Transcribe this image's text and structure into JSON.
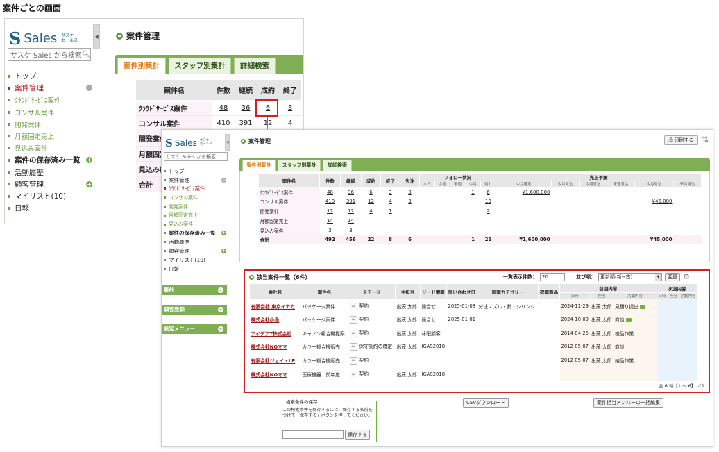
{
  "caption": "案件ごとの画面",
  "brand": {
    "letter": "S",
    "name": "Sales",
    "small_line1": "サスケ",
    "small_line2": "セールス"
  },
  "search_placeholder": "サスケ Sales から検索",
  "nav": [
    {
      "label": "トップ",
      "type": "top"
    },
    {
      "label": "案件管理",
      "type": "active",
      "toggle": "minus"
    },
    {
      "label": "ｸﾗｳﾄﾞｻｰﾋﾞｽ案件",
      "type": "sub"
    },
    {
      "label": "コンサル案件",
      "type": "sub"
    },
    {
      "label": "開発案件",
      "type": "sub"
    },
    {
      "label": "月額固定売上",
      "type": "sub"
    },
    {
      "label": "見込み案件",
      "type": "sub"
    },
    {
      "label": "案件の保存済み一覧",
      "type": "bold",
      "toggle": "plus"
    },
    {
      "label": "活動履歴",
      "type": "top"
    },
    {
      "label": "顧客管理",
      "type": "top",
      "toggle": "plus"
    },
    {
      "label": "マイリスト(10)",
      "type": "top"
    },
    {
      "label": "日報",
      "type": "top"
    }
  ],
  "sideboxes": [
    "集計",
    "顧客登録",
    "設定メニュー"
  ],
  "header": {
    "title": "案件管理",
    "print_label": "印刷する"
  },
  "tabs": [
    "案件別集計",
    "スタッフ別集計",
    "詳細検索"
  ],
  "summary": {
    "headers": [
      "案件名",
      "件数",
      "継続",
      "成約",
      "終了",
      "失注"
    ],
    "follow_header": "フォロー状況",
    "follow_sub": [
      "本日",
      "今週",
      "来週",
      "今月",
      "遅れ"
    ],
    "forecast_header": "売上予測",
    "forecast_sub": [
      "今月確定",
      "今月見込",
      "今週見込",
      "来週見込",
      "今月見込",
      "来月見込"
    ],
    "rows": [
      {
        "name": "ｸﾗｳﾄﾞｻｰﾋﾞｽ案件",
        "count": "48",
        "cont": "36",
        "won": "6",
        "end": "3",
        "lost": "3",
        "f_month": "1",
        "f_late": "6",
        "p1": "¥1,600,000",
        "p5": ""
      },
      {
        "name": "コンサル案件",
        "count": "410",
        "cont": "391",
        "won": "12",
        "end": "4",
        "lost": "3",
        "f_month": "",
        "f_late": "13",
        "p1": "",
        "p5": "¥45,000"
      },
      {
        "name": "開発案件",
        "count": "17",
        "cont": "12",
        "won": "4",
        "end": "1",
        "lost": "",
        "f_month": "",
        "f_late": "2",
        "p1": "",
        "p5": ""
      },
      {
        "name": "月額固定売上",
        "count": "14",
        "cont": "14",
        "won": "",
        "end": "",
        "lost": "",
        "f_month": "",
        "f_late": "",
        "p1": "",
        "p5": ""
      },
      {
        "name": "見込み案件",
        "count": "3",
        "cont": "3",
        "won": "",
        "end": "",
        "lost": "",
        "f_month": "",
        "f_late": "",
        "p1": "",
        "p5": ""
      }
    ],
    "total": {
      "name": "合計",
      "count": "492",
      "cont": "456",
      "won": "22",
      "end": "8",
      "lost": "6",
      "f_month": "1",
      "f_late": "21",
      "p1": "¥1,600,000",
      "p5": "¥45,000"
    }
  },
  "list": {
    "title": "該当案件一覧（6件）",
    "per_page_label": "一覧表示件数：",
    "per_page_value": "20",
    "sort_label": "並び順：",
    "sort_value": "更新順(新→古)",
    "change_label": "変更",
    "headers": [
      "会社名",
      "案件名",
      "ステージ",
      "主担当",
      "リード情報",
      "問い合わせ日",
      "提案カテゴリー",
      "提案商品",
      "前回内容",
      "次回内容"
    ],
    "prev_sub": [
      "日時",
      "担当",
      "活動内容"
    ],
    "next_sub": [
      "日時",
      "担当",
      "活動内容"
    ],
    "rows": [
      {
        "company": "有限会社 東京イナカ",
        "project": "パッケージ案件",
        "stage": "契約",
        "owner": "出茂 太郎",
        "lead": "競合せ",
        "date": "2025-01-08",
        "category": "分注ノズル・針・シリンジ",
        "product": "",
        "prev_date": "2024-11-29",
        "prev_staff": "出茂 太郎",
        "prev_act": "見積り提出",
        "chat": true
      },
      {
        "company": "株式会社小島",
        "project": "パッケージ案件",
        "stage": "契約",
        "owner": "出茂 太郎",
        "lead": "競合せ",
        "date": "2025-01-01",
        "category": "",
        "product": "",
        "prev_date": "2024-10-09",
        "prev_staff": "出茂 太郎",
        "prev_act": "商談",
        "chat": true
      },
      {
        "company": "アイデアT株式会社",
        "project": "キャノン複合機提案",
        "stage": "契約",
        "owner": "出茂 太郎",
        "lead": "休眠顧客",
        "date": "",
        "category": "",
        "product": "",
        "prev_date": "2014-04-25",
        "prev_staff": "出茂 太郎",
        "prev_act": "検品作業",
        "chat": false
      },
      {
        "company": "株式会社NOママ",
        "project": "カラー複合機販売",
        "stage": "保守契約の確定",
        "owner": "出茂 太郎",
        "lead": "IGAS2018",
        "date": "",
        "category": "",
        "product": "",
        "prev_date": "2012-05-07",
        "prev_staff": "出茂 太郎",
        "prev_act": "商談",
        "chat": false
      },
      {
        "company": "有限会社ジェイ・LP",
        "project": "カラー複合機販売",
        "stage": "契約",
        "owner": "",
        "lead": "",
        "date": "",
        "category": "",
        "product": "",
        "prev_date": "2012-05-07",
        "prev_staff": "出茂 太郎",
        "prev_act": "納品作業",
        "chat": false
      },
      {
        "company": "株式会社NOママ",
        "project": "医療機器　前年度",
        "stage": "契約",
        "owner": "出茂 太郎",
        "lead": "IGAS2018",
        "date": "",
        "category": "",
        "product": "",
        "prev_date": "",
        "prev_staff": "",
        "prev_act": "",
        "chat": false
      }
    ],
    "pager": "全 6 件【1 〜 6】 ／1"
  },
  "save_search": {
    "legend": "検索条件の保存",
    "description": "この検索条件を保存するには、保存する名前をつけて「保存する」ボタンを押してください。",
    "button": "保存する"
  },
  "csv_label": "CSVダウンロード",
  "bulk_label": "案件担当メンバーの一括編集",
  "colors": {
    "accent_green": "#7fae55",
    "highlight_red": "#d12020",
    "active_red": "#b71c1c",
    "tab_orange": "#e07b14"
  }
}
